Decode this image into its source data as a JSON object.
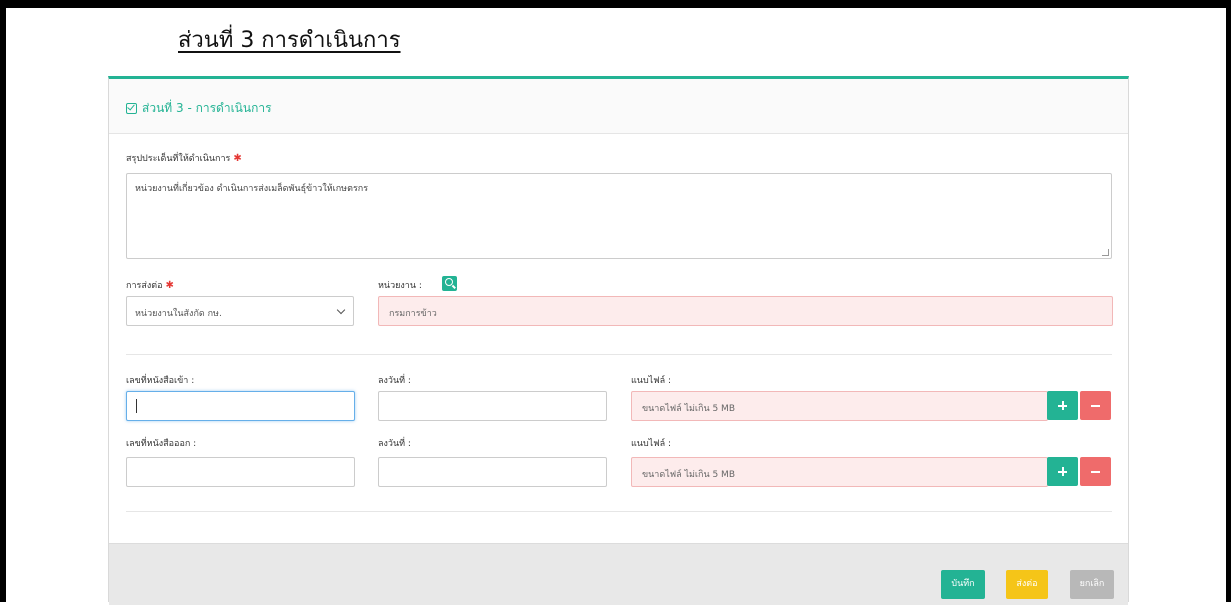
{
  "page": {
    "heading": "ส่วนที่ 3 การดำเนินการ"
  },
  "panel": {
    "title": "ส่วนที่ 3 - การดำเนินการ",
    "summary": {
      "label": "สรุปประเด็นที่ให้ดำเนินการ",
      "required_mark": "✱",
      "value": "หน่วยงานที่เกี่ยวข้อง ดำเนินการส่งเมล็ดพันธุ์ข้าวให้เกษตรกร"
    },
    "forward": {
      "label": "การส่งต่อ",
      "required_mark": "✱",
      "selected": "หน่วยงานในสังกัด กษ."
    },
    "agency": {
      "label": "หน่วยงาน :",
      "value": "กรมการข้าว"
    },
    "incoming": {
      "doc_no_label": "เลขที่หนังสือเข้า :",
      "date_label": "ลงวันที่ :",
      "file_label": "แนบไฟล์ :",
      "file_placeholder": "ขนาดไฟล์ ไม่เกิน 5 MB"
    },
    "outgoing": {
      "doc_no_label": "เลขที่หนังสือออก :",
      "date_label": "ลงวันที่ :",
      "file_label": "แนบไฟล์ :",
      "file_placeholder": "ขนาดไฟล์ ไม่เกิน 5 MB"
    }
  },
  "footer": {
    "save_label": "บันทึก",
    "send_label": "ส่งต่อ",
    "cancel_label": "ยกเลิก"
  },
  "colors": {
    "accent": "#23b394",
    "danger": "#ef6b6b",
    "warning": "#f5c518",
    "muted": "#b8b8b8",
    "required": "#e53935"
  }
}
